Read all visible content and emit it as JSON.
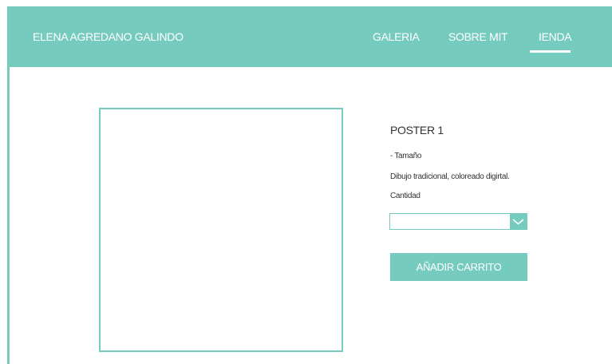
{
  "header": {
    "brand": "ELENA AGREDANO GALINDO",
    "nav": [
      {
        "label": "GALERIA"
      },
      {
        "label": "SOBRE MIT"
      },
      {
        "label": "IENDA"
      }
    ],
    "active_nav": "IENDA"
  },
  "product": {
    "title": "POSTER 1",
    "size_label": "- Tamaño",
    "description": "Dibujo tradicional, coloreado digirtal.",
    "quantity_label": "Cantidad",
    "quantity_value": "",
    "add_to_cart_label": "AÑADIR CARRITO"
  },
  "colors": {
    "accent": "#75cbbd",
    "text": "#333333",
    "background": "#ffffff"
  },
  "icons": {
    "quantity_dropdown": "chevron-down-icon"
  }
}
